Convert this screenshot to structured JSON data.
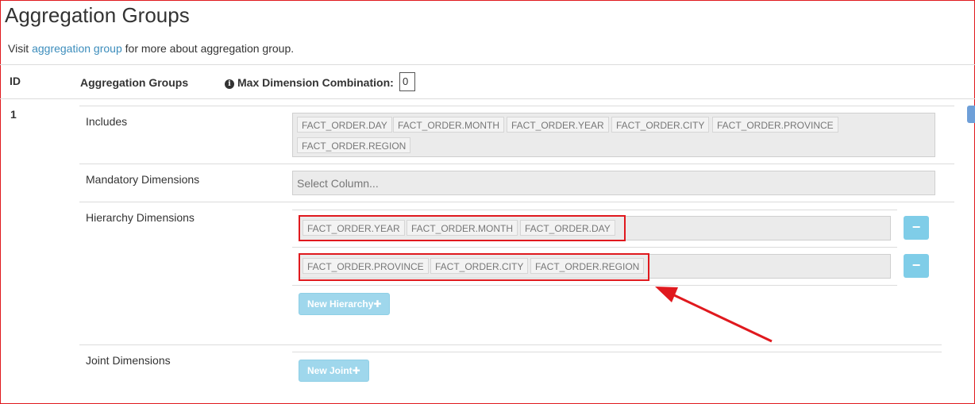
{
  "page": {
    "title": "Aggregation Groups",
    "visit_prefix": "Visit ",
    "visit_link": "aggregation group",
    "visit_suffix": " for more about aggregation group."
  },
  "table_header": {
    "id": "ID",
    "groups": "Aggregation Groups",
    "info_icon": "i",
    "max_dim_label": "Max Dimension Combination:",
    "max_dim_value": "0"
  },
  "group": {
    "id": "1",
    "includes_label": "Includes",
    "includes": [
      "FACT_ORDER.DAY",
      "FACT_ORDER.MONTH",
      "FACT_ORDER.YEAR",
      "FACT_ORDER.CITY",
      "FACT_ORDER.PROVINCE",
      "FACT_ORDER.REGION"
    ],
    "mandatory_label": "Mandatory Dimensions",
    "mandatory_placeholder": "Select Column...",
    "hierarchy_label": "Hierarchy Dimensions",
    "hierarchies": [
      [
        "FACT_ORDER.YEAR",
        "FACT_ORDER.MONTH",
        "FACT_ORDER.DAY"
      ],
      [
        "FACT_ORDER.PROVINCE",
        "FACT_ORDER.CITY",
        "FACT_ORDER.REGION"
      ]
    ],
    "remove_symbol": "−",
    "new_hierarchy_label": "New Hierarchy✚",
    "joint_label": "Joint Dimensions",
    "new_joint_label": "New Joint✚"
  },
  "colors": {
    "annotation": "#e0191e",
    "button": "#7fcde8",
    "link": "#3c8dbc"
  }
}
